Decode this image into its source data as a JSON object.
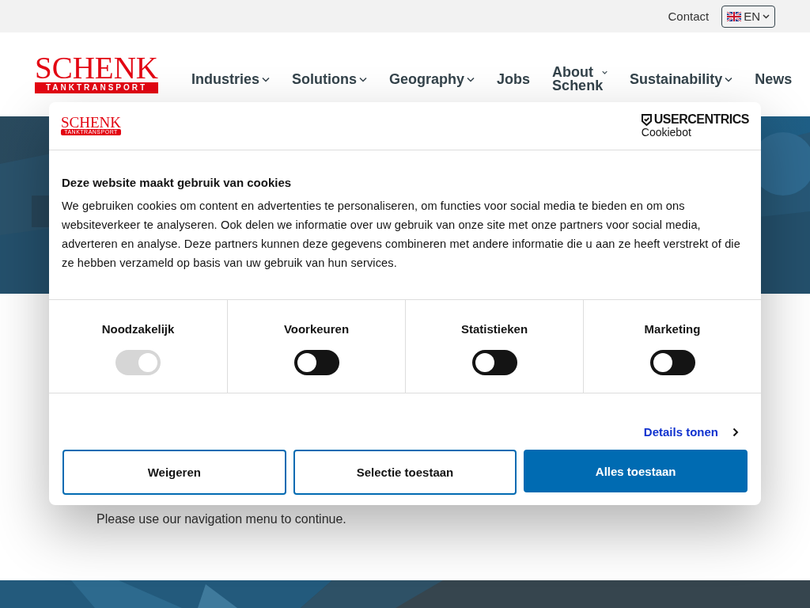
{
  "top_bar": {
    "contact": "Contact",
    "language": "EN"
  },
  "header": {
    "logo": {
      "name": "SCHENK",
      "sub": "TANKTRANSPORT"
    },
    "nav": [
      {
        "label": "Industries",
        "dropdown": true
      },
      {
        "label": "Solutions",
        "dropdown": true
      },
      {
        "label": "Geography",
        "dropdown": true
      },
      {
        "label": "Jobs",
        "dropdown": false
      },
      {
        "label": "About Schenk",
        "dropdown": true
      },
      {
        "label": "Sustainability",
        "dropdown": true
      },
      {
        "label": "News",
        "dropdown": false
      }
    ]
  },
  "content": {
    "text": "Please use our navigation menu to continue."
  },
  "cookie_dialog": {
    "logo": {
      "name": "SCHENK",
      "sub": "TANKTRANSPORT"
    },
    "provider": {
      "name": "USERCENTRICS",
      "product": "Cookiebot"
    },
    "title": "Deze website maakt gebruik van cookies",
    "text": "We gebruiken cookies om content en advertenties te personaliseren, om functies voor social media te bieden en om ons websiteverkeer te analyseren. Ook delen we informatie over uw gebruik van onze site met onze partners voor social media, adverteren en analyse. Deze partners kunnen deze gegevens combineren met andere informatie die u aan ze heeft verstrekt of die ze hebben verzameld op basis van uw gebruik van hun services.",
    "categories": [
      {
        "label": "Noodzakelijk",
        "checked": true,
        "disabled": true
      },
      {
        "label": "Voorkeuren",
        "checked": false,
        "disabled": false
      },
      {
        "label": "Statistieken",
        "checked": false,
        "disabled": false
      },
      {
        "label": "Marketing",
        "checked": false,
        "disabled": false
      }
    ],
    "details_link": "Details tonen",
    "buttons": [
      {
        "label": "Weigeren",
        "kind": "outline"
      },
      {
        "label": "Selectie toestaan",
        "kind": "outline"
      },
      {
        "label": "Alles toestaan",
        "kind": "primary"
      }
    ]
  }
}
